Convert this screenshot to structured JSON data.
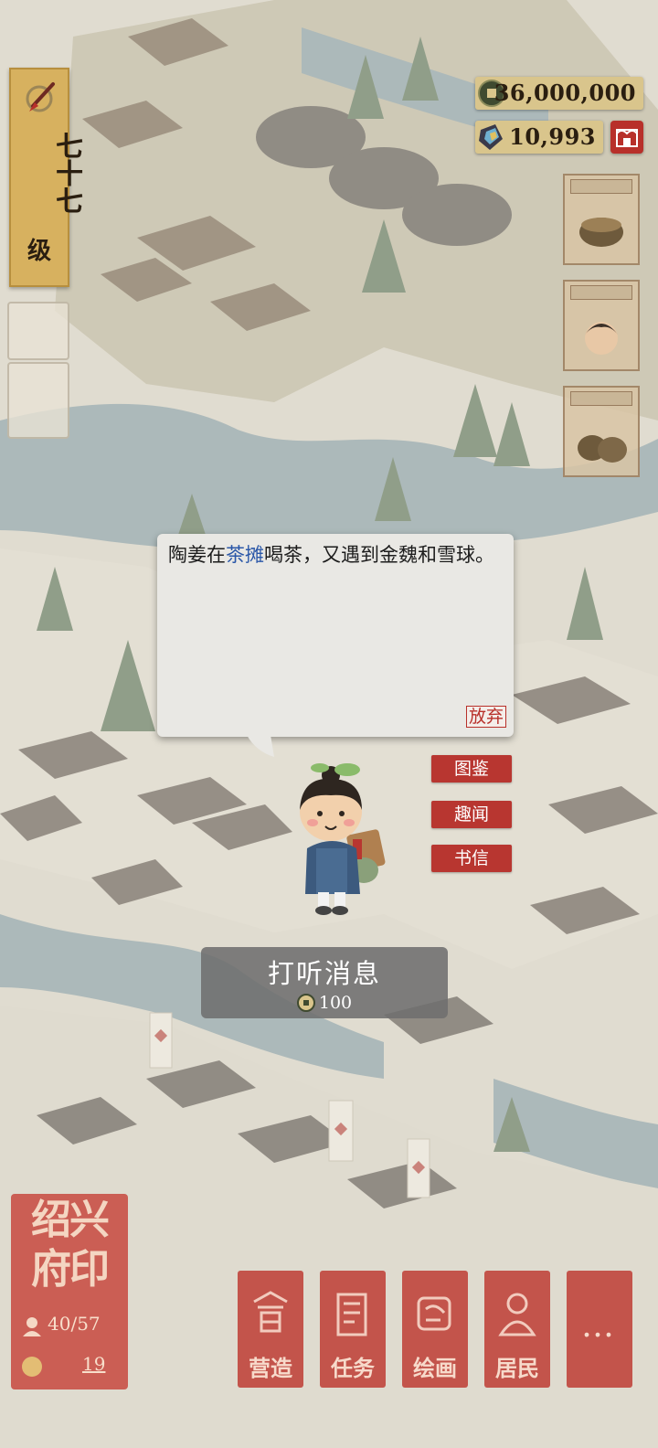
{
  "hud": {
    "level": {
      "value": "七十七",
      "unit": "级"
    },
    "coins": {
      "icon": "copper-coin-icon",
      "value": "36,000,000"
    },
    "gems": {
      "icon": "jade-token-icon",
      "value": "10,993"
    },
    "shop": {
      "icon": "shop-icon"
    }
  },
  "dialog": {
    "text_before": "陶姜在",
    "text_highlight": "茶摊",
    "text_after": "喝茶，又遇到金魏和雪球。",
    "give_up_label": "放弃"
  },
  "side_buttons": [
    {
      "label": "图鉴"
    },
    {
      "label": "趣闻"
    },
    {
      "label": "书信"
    }
  ],
  "inquire": {
    "label": "打听消息",
    "cost": "100",
    "cost_icon": "copper-coin-icon"
  },
  "seal": {
    "city": "绍兴府印",
    "population": "40/57",
    "count": "19"
  },
  "menu": [
    {
      "label": "营造",
      "icon": "build-icon"
    },
    {
      "label": "任务",
      "icon": "task-icon"
    },
    {
      "label": "绘画",
      "icon": "paint-icon"
    },
    {
      "label": "居民",
      "icon": "resident-icon"
    },
    {
      "label": "…",
      "icon": "more-icon"
    }
  ],
  "colors": {
    "accent_red": "#b83630",
    "highlight_blue": "#2a57a8",
    "badge_gold": "#d7b15f"
  }
}
